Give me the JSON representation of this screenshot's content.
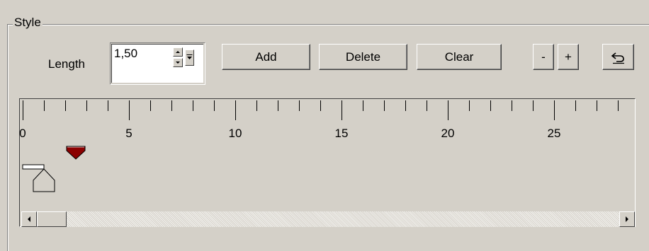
{
  "group": {
    "title": "Style"
  },
  "length": {
    "label": "Length",
    "value": "1,50"
  },
  "buttons": {
    "add": "Add",
    "delete": "Delete",
    "clear": "Clear",
    "minus": "-",
    "plus": "+"
  },
  "icons": {
    "undo": "undo-icon",
    "stop_marker": "stop-marker-icon",
    "indent_marker": "indent-marker-icon"
  },
  "ruler": {
    "min": 0,
    "max": 28,
    "minor_step": 1,
    "major_step": 5,
    "labels": [
      "0",
      "5",
      "10",
      "15",
      "20",
      "25"
    ],
    "stop_position": 2.5,
    "indent_position": 0.5
  },
  "colors": {
    "face": "#d4d0c8",
    "stop_marker": "#8b0000"
  }
}
